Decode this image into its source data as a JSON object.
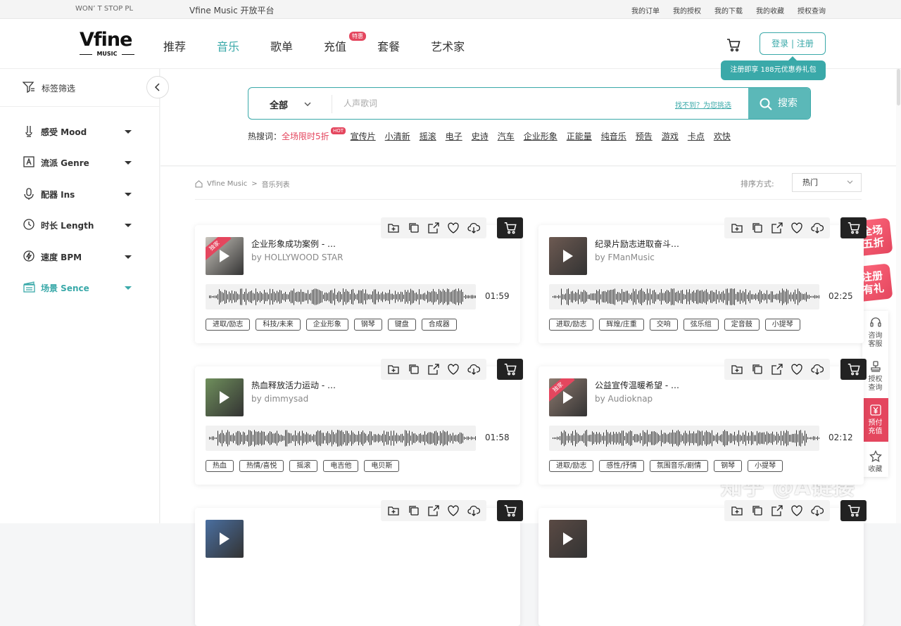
{
  "topbar": {
    "ticker": "WON’ T STOP PL",
    "platform": "Vfine Music 开放平台",
    "links": [
      "我的订单",
      "我的授权",
      "我的下载",
      "我的收藏",
      "授权查询"
    ]
  },
  "header": {
    "logo_main": "Vfine",
    "logo_sub": "MUSIC",
    "nav": [
      {
        "label": "推荐"
      },
      {
        "label": "音乐",
        "active": true
      },
      {
        "label": "歌单"
      },
      {
        "label": "充值",
        "badge": "特惠"
      },
      {
        "label": "套餐"
      },
      {
        "label": "艺术家"
      }
    ],
    "login_label": "登录 | 注册",
    "register_tip": "注册即享 188元优惠券礼包"
  },
  "sidebar": {
    "filter_label": "标签筛选",
    "items": [
      {
        "label": "感受 Mood",
        "icon": "mood-icon"
      },
      {
        "label": "流派 Genre",
        "icon": "genre-icon"
      },
      {
        "label": "配器 Ins",
        "icon": "microphone-icon"
      },
      {
        "label": "时长 Length",
        "icon": "clock-icon"
      },
      {
        "label": "速度 BPM",
        "icon": "speed-icon"
      },
      {
        "label": "场景 Sence",
        "icon": "scene-icon",
        "active": true
      }
    ]
  },
  "search": {
    "category": "全部",
    "placeholder": "人声歌词",
    "not_found": "找不到？为您挑选",
    "button_label": "搜索",
    "hot_label": "热搜词：",
    "promo": "全场限时5折",
    "promo_badge": "HOT",
    "keywords": [
      "宣传片",
      "小清新",
      "摇滚",
      "电子",
      "史诗",
      "汽车",
      "企业形象",
      "正能量",
      "纯音乐",
      "预告",
      "游戏",
      "卡点",
      "欢快"
    ]
  },
  "list": {
    "breadcrumb": [
      "Vfine Music",
      "音乐列表"
    ],
    "sort_label": "排序方式:",
    "sort_value": "热门"
  },
  "tracks": [
    {
      "title": "企业形象成功案例 - …",
      "artist": "by HOLLYWOOD STAR",
      "duration": "01:59",
      "tags": [
        "进取/励志",
        "科技/未来",
        "企业形象",
        "钢琴",
        "键盘",
        "合成器"
      ],
      "ribbon": "独家",
      "thumb_color": "#c9c5bd"
    },
    {
      "title": "纪录片励志进取奋斗…",
      "artist": "by FManMusic",
      "duration": "02:25",
      "tags": [
        "进取/励志",
        "辉煌/庄重",
        "交响",
        "弦乐组",
        "定音鼓",
        "小提琴"
      ],
      "ribbon": "",
      "thumb_color": "#6d5a52"
    },
    {
      "title": "热血释放活力运动 - …",
      "artist": "by dimmysad",
      "duration": "01:58",
      "tags": [
        "热血",
        "热情/喜悦",
        "摇滚",
        "电吉他",
        "电贝斯"
      ],
      "ribbon": "",
      "thumb_color": "#6f8f5c"
    },
    {
      "title": "公益宣传温暖希望 - …",
      "artist": "by Audioknap",
      "duration": "02:12",
      "tags": [
        "进取/励志",
        "感性/抒情",
        "氛围音乐/剧情",
        "钢琴",
        "小提琴"
      ],
      "ribbon": "独家",
      "thumb_color": "#8f7b70"
    },
    {
      "title": "",
      "artist": "",
      "duration": "",
      "tags": [],
      "ribbon": "",
      "thumb_color": "#4a6fa0"
    },
    {
      "title": "",
      "artist": "",
      "duration": "",
      "tags": [],
      "ribbon": "",
      "thumb_color": "#5a4a44"
    }
  ],
  "float": {
    "promo1": [
      "全场",
      "五折"
    ],
    "promo2": [
      "注册",
      "有礼"
    ],
    "side_items": [
      {
        "label": "咨询客服",
        "icon": "headset-icon"
      },
      {
        "label": "授权查询",
        "icon": "stamp-icon"
      },
      {
        "label": "预付充值",
        "icon": "yen-card-icon"
      },
      {
        "label": "收藏",
        "icon": "star-icon"
      }
    ]
  },
  "watermark": "知乎 @A链接",
  "colors": {
    "accent": "#3aa9a9",
    "hot": "#e4465e"
  }
}
